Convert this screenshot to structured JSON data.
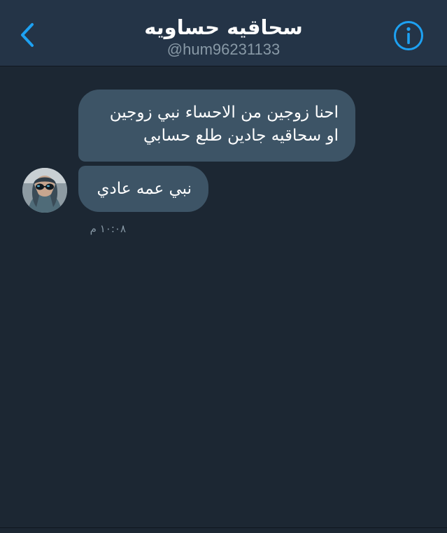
{
  "header": {
    "title": "سحاقيه حساويه",
    "handle": "@hum96231133",
    "back_icon": "chevron-left-icon",
    "info_icon": "info-circle-icon"
  },
  "conversation": {
    "messages": [
      {
        "lines": [
          "احنا زوجين من الاحساء نبي زوجين",
          "او سحاقيه جادين طلع حسابي"
        ]
      },
      {
        "lines": [
          "نبي عمه عادي"
        ]
      }
    ],
    "timestamp": "١٠:٠٨ م"
  },
  "colors": {
    "background": "#1c2733",
    "header": "#243447",
    "bubble": "#3d5466",
    "accent": "#1da1f2",
    "muted": "#8899a6"
  }
}
